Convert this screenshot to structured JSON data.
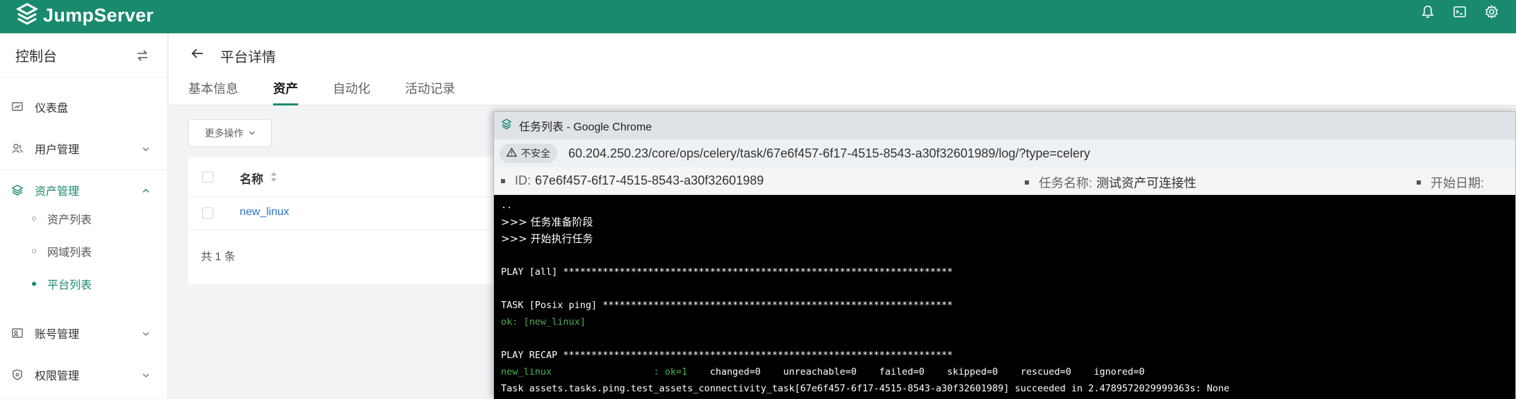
{
  "app": {
    "name": "JumpServer",
    "brand_color": "#1a8a6e"
  },
  "header_icons": [
    "bell-icon",
    "terminal-icon",
    "gear-icon"
  ],
  "sidebar": {
    "title": "控制台",
    "items": [
      {
        "label": "仪表盘"
      },
      {
        "label": "用户管理"
      },
      {
        "label": "资产管理"
      },
      {
        "label": "账号管理"
      },
      {
        "label": "权限管理"
      }
    ],
    "sub_items": [
      {
        "label": "资产列表"
      },
      {
        "label": "网域列表"
      },
      {
        "label": "平台列表"
      }
    ]
  },
  "page": {
    "title": "平台详情",
    "tabs": [
      {
        "label": "基本信息"
      },
      {
        "label": "资产"
      },
      {
        "label": "自动化"
      },
      {
        "label": "活动记录"
      }
    ],
    "active_tab": "资产",
    "more_actions": "更多操作",
    "table": {
      "columns": [
        "名称"
      ],
      "rows": [
        {
          "name": "new_linux"
        }
      ],
      "total": "共 1 条"
    }
  },
  "popup": {
    "window_title": "任务列表 - Google Chrome",
    "insecure_label": "不安全",
    "url": "60.204.250.23/core/ops/celery/task/67e6f457-6f17-4515-8543-a30f32601989/log/?type=celery",
    "info": {
      "id_label": "ID:",
      "id_value": "67e6f457-6f17-4515-8543-a30f32601989",
      "task_label": "任务名称:",
      "task_value": "测试资产可连接性",
      "start_label": "开始日期:"
    },
    "terminal": {
      "l1": "..",
      "l2": ">>> 任务准备阶段",
      "l3": ">>> 开始执行任务",
      "l4": "",
      "l5": "PLAY [all] *********************************************************************",
      "l6": "",
      "l7": "TASK [Posix ping] **************************************************************",
      "l8": "ok: [new_linux]",
      "l9": "",
      "l10": "PLAY RECAP *********************************************************************",
      "recap_host": "new_linux                  : ",
      "recap_ok": "ok=1",
      "recap_rest": "    changed=0    unreachable=0    failed=0    skipped=0    rescued=0    ignored=0",
      "l12": "Task assets.tasks.ping.test_assets_connectivity_task[67e6f457-6f17-4515-8543-a30f32601989] succeeded in 2.4789572029999363s: None"
    }
  }
}
